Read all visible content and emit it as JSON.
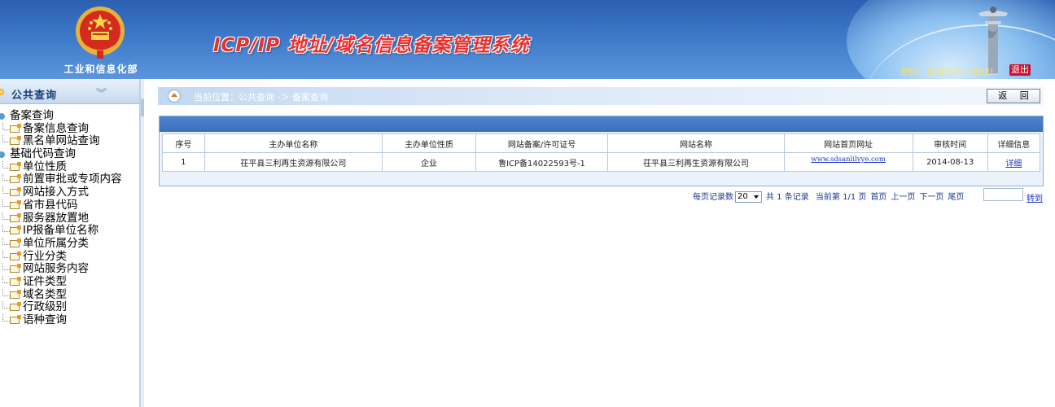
{
  "header": {
    "ministry_name": "工业和信息化部",
    "system_title": "ICP/IP 地址/域名信息备案管理系统",
    "welcome": "您好，欢迎访问本系统!",
    "logout": "退出"
  },
  "sidebar": {
    "panel_title": "公共查询",
    "collapse_glyph": "︾",
    "tree": [
      {
        "label": "备案查询",
        "children": [
          "备案信息查询",
          "黑名单网站查询"
        ]
      },
      {
        "label": "基础代码查询",
        "children": [
          "单位性质",
          "前置审批或专项内容",
          "网站接入方式",
          "省市县代码",
          "服务器放置地",
          "IP报备单位名称",
          "单位所属分类",
          "行业分类",
          "网站服务内容",
          "证件类型",
          "域名类型",
          "行政级别",
          "语种查询"
        ]
      }
    ]
  },
  "breadcrumb": {
    "text": "当前位置：公共查询  -＞  备案查询"
  },
  "back_button": "返 回",
  "table": {
    "columns": [
      "序号",
      "主办单位名称",
      "主办单位性质",
      "网站备案/许可证号",
      "网站名称",
      "网站首页网址",
      "审核时间",
      "详细信息"
    ],
    "rows": [
      {
        "index": "1",
        "org_name": "茌平县三利再生资源有限公司",
        "org_type": "企业",
        "license": "鲁ICP备14022593号-1",
        "site_name": "茌平县三利再生资源有限公司",
        "url": "www.sdsanlilvye.com",
        "date": "2014-08-13",
        "detail": "详细"
      }
    ]
  },
  "pager": {
    "per_page_label": "每页记录数",
    "per_page_value": "20",
    "total": "共 1 条记录",
    "current": "当前第 1/1 页",
    "first": "首页",
    "prev": "上一页",
    "next": "下一页",
    "last": "尾页",
    "jump": "转到"
  },
  "colors": {
    "header_blue": "#3d78c8",
    "title_red": "#e8312f",
    "link_blue": "#1f36c8",
    "logout_red": "#c8102e"
  }
}
